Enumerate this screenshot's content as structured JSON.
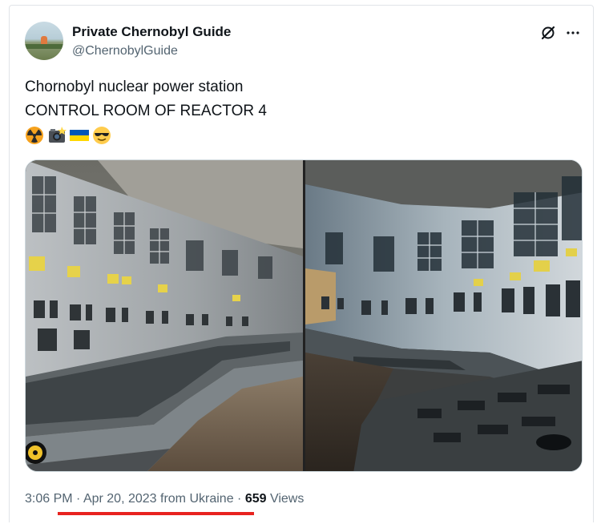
{
  "author": {
    "name": "Private Chernobyl Guide",
    "handle": "@ChernobylGuide"
  },
  "tweet": {
    "line1": "Chornobyl nuclear power station",
    "line2": "CONTROL ROOM OF REACTOR 4",
    "emojis": [
      "radioactive-icon",
      "camera-flash-icon",
      "ukraine-flag-icon",
      "sunglasses-face-icon"
    ]
  },
  "media": {
    "images": [
      "control-room-photo-left",
      "control-room-photo-right"
    ]
  },
  "meta": {
    "time": "3:06 PM",
    "sep1": " · ",
    "date": "Apr 20, 2023",
    "from": " from Ukraine",
    "sep2": " · ",
    "views_count": "659",
    "views_label": " Views"
  },
  "colors": {
    "text": "#0f1419",
    "secondary": "#536471",
    "border": "#cfd9de",
    "annotation_red": "#e8231f",
    "ukraine_blue": "#0057b7",
    "ukraine_yellow": "#ffd700"
  }
}
